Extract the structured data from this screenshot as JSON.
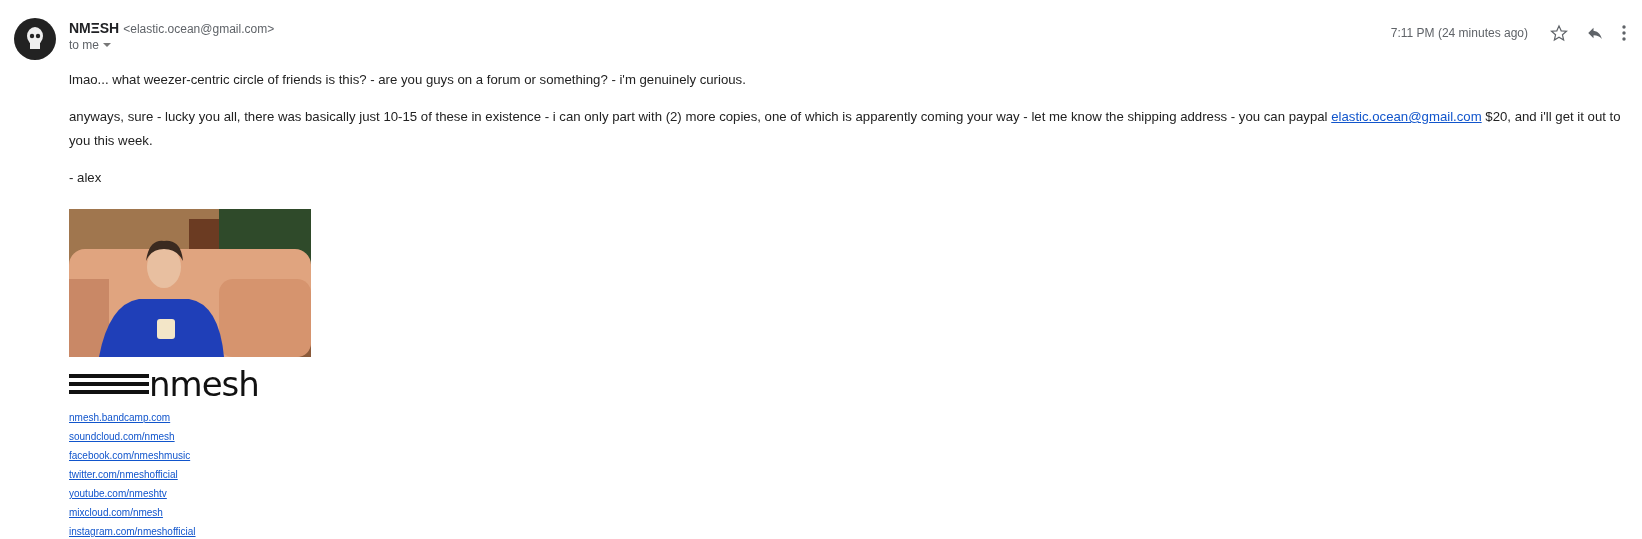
{
  "message": {
    "sender_name": "NMΞSH",
    "sender_email": "<elastic.ocean@gmail.com>",
    "recipient": "to me",
    "time": "7:11 PM (24 minutes ago)",
    "starred": false,
    "body": [
      {
        "parts": [
          {
            "kind": "text",
            "text": "lmao... what weezer-centric circle of friends is this? - are you guys on a forum or something? - i'm genuinely curious."
          }
        ]
      },
      {
        "parts": [
          {
            "kind": "text",
            "text": "anyways, sure - lucky you all, there was basically just 10-15 of these in existence - i can only part with (2) more copies, one of which is apparently coming your way - let me know the shipping address - you can paypal "
          },
          {
            "kind": "link",
            "text": "elastic.ocean@gmail.com"
          },
          {
            "kind": "text",
            "text": " $20, and i'll get it out to you this week."
          }
        ]
      },
      {
        "parts": [
          {
            "kind": "text",
            "text": "- alex"
          }
        ]
      }
    ],
    "signature": {
      "logo": "nmesh",
      "links": [
        "nmesh.bandcamp.com",
        "soundcloud.com/nmesh",
        "facebook.com/nmeshmusic",
        "twitter.com/nmeshofficial",
        "youtube.com/nmeshtv",
        "mixcloud.com/nmesh",
        "instagram.com/nmeshofficial"
      ]
    }
  }
}
